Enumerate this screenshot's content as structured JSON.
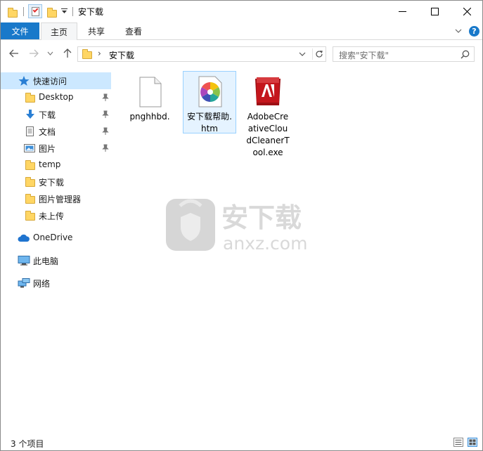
{
  "window": {
    "title": "安下载"
  },
  "ribbon": {
    "file_tab": "文件",
    "tabs": [
      "主页",
      "共享",
      "查看"
    ],
    "help": "?"
  },
  "address": {
    "path": "安下载",
    "chevron": "›"
  },
  "search": {
    "placeholder": "搜索\"安下载\""
  },
  "nav": {
    "quick_access": "快速访问",
    "pinned": [
      "Desktop",
      "下载",
      "文档",
      "图片"
    ],
    "folders": [
      "temp",
      "安下载",
      "图片管理器",
      "未上传"
    ],
    "onedrive": "OneDrive",
    "this_pc": "此电脑",
    "network": "网络"
  },
  "files": [
    {
      "name": "pnghhbd.",
      "icon": "blank-file-icon"
    },
    {
      "name": "安下载帮助.htm",
      "icon": "htm-colorwheel-icon"
    },
    {
      "name": "AdobeCreativeCloudCleanerTool.exe",
      "icon": "adobe-exe-icon"
    }
  ],
  "watermark": {
    "text": "安下载",
    "subtext": "anxz.com"
  },
  "status": {
    "item_count": "3 个项目"
  },
  "colors": {
    "accent": "#1979ca",
    "selected": "#cce8ff",
    "folder": "#ffd664",
    "adobe": "#c4161c"
  }
}
